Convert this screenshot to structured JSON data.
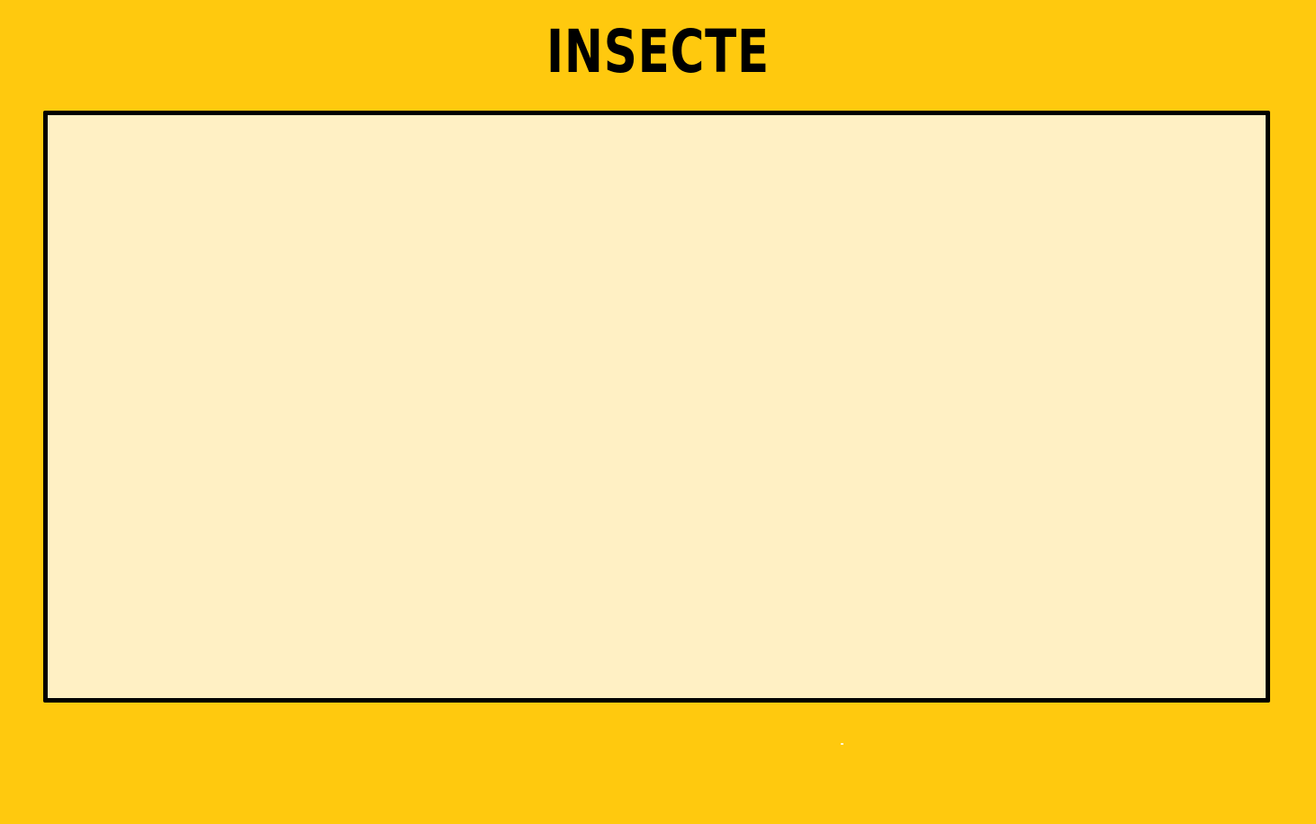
{
  "title": "INSECTE",
  "colors": {
    "background": "#FFC90E",
    "panel_fill": "#FFF0C4",
    "panel_border": "#000000",
    "title_text": "#000000"
  }
}
